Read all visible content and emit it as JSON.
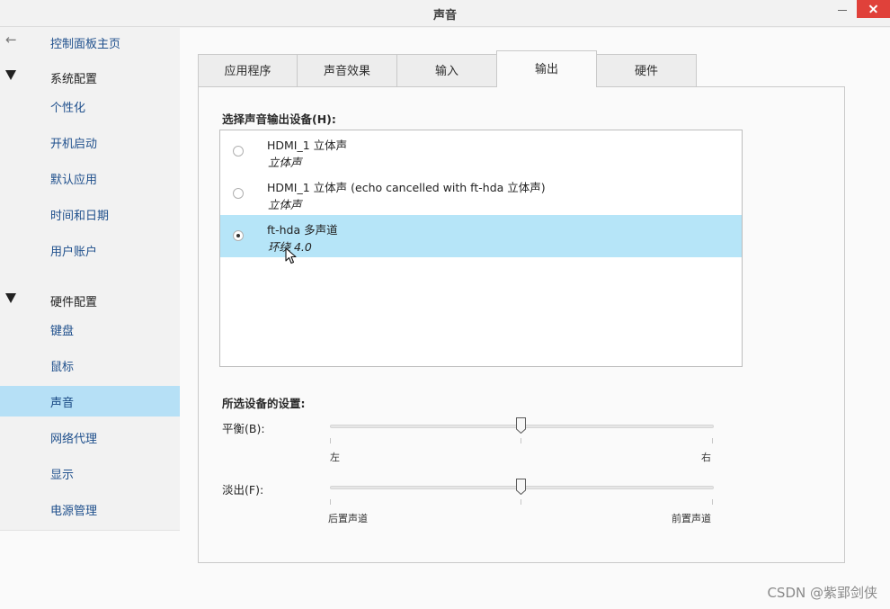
{
  "window": {
    "title": "声音"
  },
  "sidebar": {
    "back_label": "控制面板主页",
    "groups": [
      {
        "label": "系统配置",
        "items": [
          {
            "label": "个性化"
          },
          {
            "label": "开机启动"
          },
          {
            "label": "默认应用"
          },
          {
            "label": "时间和日期"
          },
          {
            "label": "用户账户"
          }
        ]
      },
      {
        "label": "硬件配置",
        "items": [
          {
            "label": "键盘"
          },
          {
            "label": "鼠标"
          },
          {
            "label": "声音",
            "selected": true
          },
          {
            "label": "网络代理"
          },
          {
            "label": "显示"
          },
          {
            "label": "电源管理"
          }
        ]
      }
    ]
  },
  "tabs": [
    {
      "label": "应用程序"
    },
    {
      "label": "声音效果"
    },
    {
      "label": "输入"
    },
    {
      "label": "输出",
      "active": true
    },
    {
      "label": "硬件"
    }
  ],
  "output": {
    "device_label": "选择声音输出设备(H):",
    "devices": [
      {
        "name": "HDMI_1 立体声",
        "profile": "立体声",
        "selected": false
      },
      {
        "name": "HDMI_1 立体声 (echo cancelled with ft-hda 立体声)",
        "profile": "立体声",
        "selected": false
      },
      {
        "name": "ft-hda 多声道",
        "profile": "环绕 4.0",
        "selected": true
      }
    ],
    "settings_label": "所选设备的设置:",
    "balance": {
      "label": "平衡(B):",
      "left_label": "左",
      "right_label": "右",
      "value": 0.5
    },
    "fade": {
      "label": "淡出(F):",
      "left_label": "后置声道",
      "right_label": "前置声道",
      "value": 0.5
    }
  },
  "watermark": "CSDN @紫郢剑侠",
  "colors": {
    "selection": "#b6e5f8",
    "close_button": "#e0413a",
    "link": "#1e4f8c"
  }
}
